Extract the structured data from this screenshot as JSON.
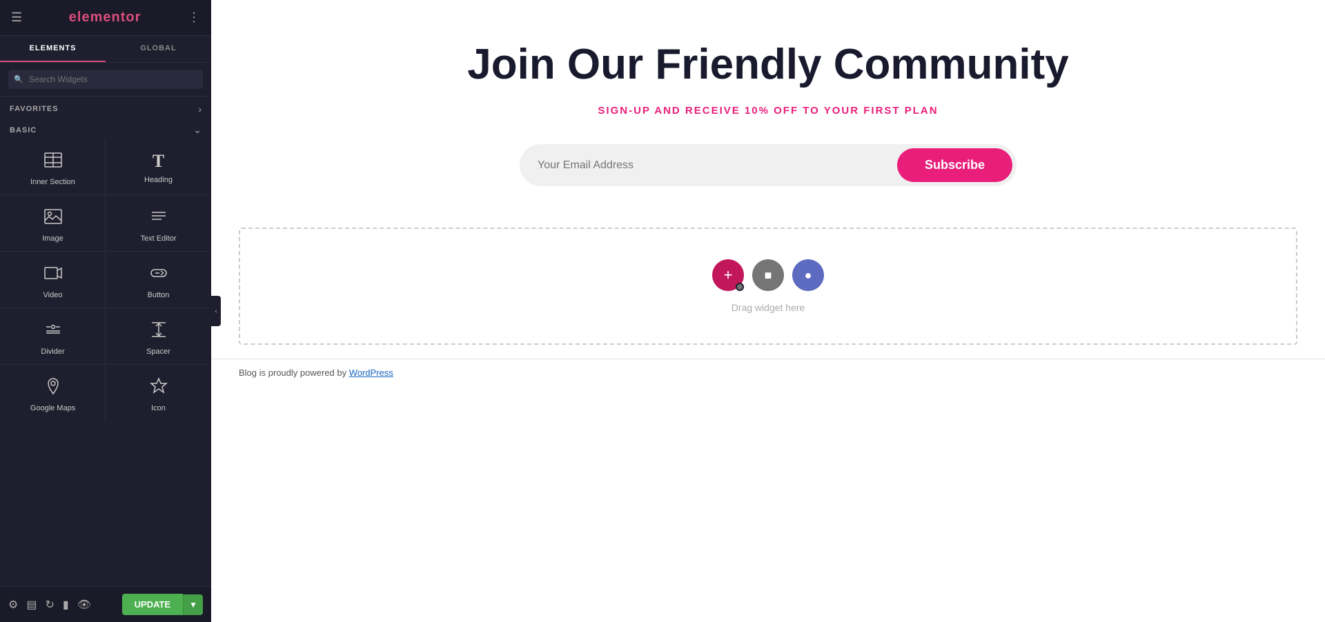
{
  "app": {
    "name": "elementor",
    "logo_text": "elementor"
  },
  "sidebar": {
    "tabs": [
      {
        "id": "elements",
        "label": "ELEMENTS",
        "active": true
      },
      {
        "id": "global",
        "label": "GLOBAL",
        "active": false
      }
    ],
    "search": {
      "placeholder": "Search Widgets"
    },
    "sections": {
      "favorites": {
        "title": "FAVORITES",
        "collapsed": false
      },
      "basic": {
        "title": "BASIC",
        "collapsed": false
      }
    },
    "widgets": [
      {
        "id": "inner-section",
        "label": "Inner Section",
        "icon": "inner-section-icon"
      },
      {
        "id": "heading",
        "label": "Heading",
        "icon": "heading-icon"
      },
      {
        "id": "image",
        "label": "Image",
        "icon": "image-icon"
      },
      {
        "id": "text-editor",
        "label": "Text Editor",
        "icon": "text-editor-icon"
      },
      {
        "id": "video",
        "label": "Video",
        "icon": "video-icon"
      },
      {
        "id": "button",
        "label": "Button",
        "icon": "button-icon"
      },
      {
        "id": "divider",
        "label": "Divider",
        "icon": "divider-icon"
      },
      {
        "id": "spacer",
        "label": "Spacer",
        "icon": "spacer-icon"
      },
      {
        "id": "google-maps",
        "label": "Google Maps",
        "icon": "google-maps-icon"
      },
      {
        "id": "icon",
        "label": "Icon",
        "icon": "icon-icon"
      }
    ],
    "bottom": {
      "update_label": "UPDATE"
    }
  },
  "page": {
    "hero_title": "Join Our Friendly Community",
    "hero_subtitle": "SIGN-UP AND RECEIVE 10% OFF TO YOUR FIRST PLAN",
    "email_placeholder": "Your Email Address",
    "subscribe_label": "Subscribe",
    "drop_label": "Drag widget here",
    "footer_text": "Blog is proudly powered by ",
    "footer_link": "WordPress",
    "footer_link_url": "#"
  },
  "colors": {
    "accent": "#e91e7a",
    "sidebar_bg": "#1e1e2e",
    "update_green": "#4caf50",
    "template_purple": "#5c6bc0",
    "folder_gray": "#757575"
  }
}
